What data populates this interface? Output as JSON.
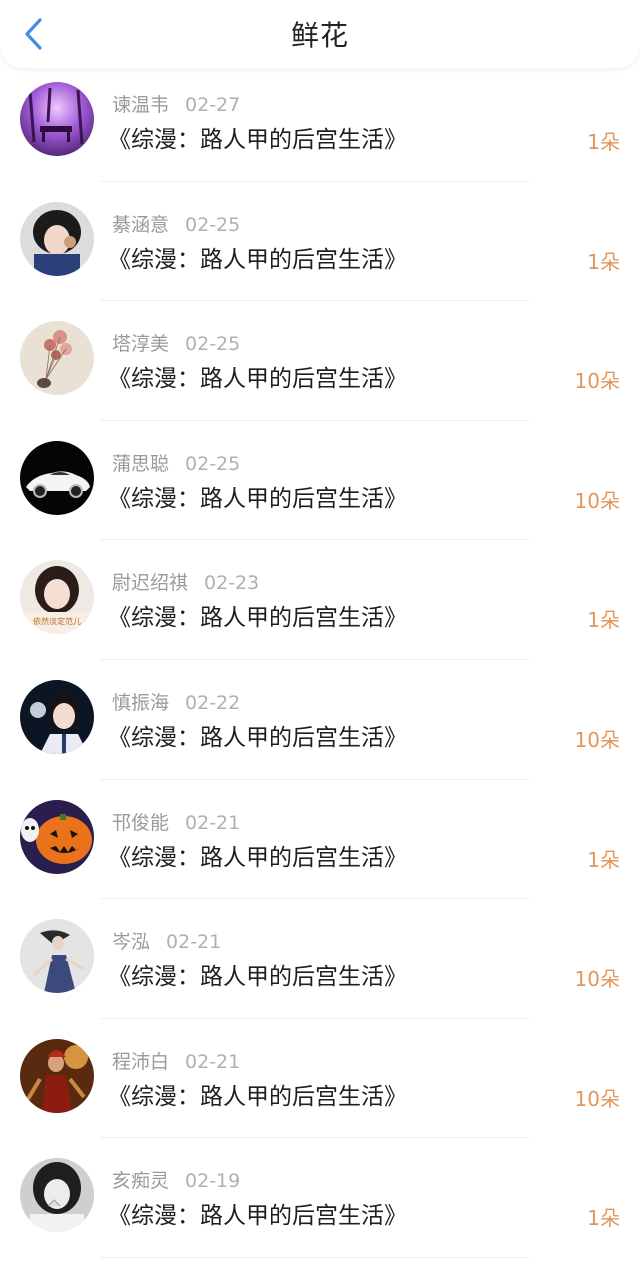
{
  "header": {
    "title": "鲜花",
    "back_icon": "chevron-left-icon",
    "accent_color": "#3d8fe6"
  },
  "gift_color": "#e3955a",
  "gifts": [
    {
      "user": "谏温韦",
      "date": "02-27",
      "book": "《综漫：路人甲的后宫生活》",
      "count": "1朵",
      "avatar": "purple-forest-avatar"
    },
    {
      "user": "綦涵意",
      "date": "02-25",
      "book": "《综漫：路人甲的后宫生活》",
      "count": "1朵",
      "avatar": "girl-photo-avatar"
    },
    {
      "user": "塔淳美",
      "date": "02-25",
      "book": "《综漫：路人甲的后宫生活》",
      "count": "10朵",
      "avatar": "balloons-avatar"
    },
    {
      "user": "蒲思聪",
      "date": "02-25",
      "book": "《综漫：路人甲的后宫生活》",
      "count": "10朵",
      "avatar": "sports-car-avatar"
    },
    {
      "user": "尉迟绍祺",
      "date": "02-23",
      "book": "《综漫：路人甲的后宫生活》",
      "count": "1朵",
      "avatar": "girl-portrait-avatar",
      "avatar_text": "依然淡定范儿"
    },
    {
      "user": "慎振海",
      "date": "02-22",
      "book": "《综漫：路人甲的后宫生活》",
      "count": "10朵",
      "avatar": "boy-portrait-avatar"
    },
    {
      "user": "邗俊能",
      "date": "02-21",
      "book": "《综漫：路人甲的后宫生活》",
      "count": "1朵",
      "avatar": "pumpkin-avatar"
    },
    {
      "user": "岑泓",
      "date": "02-21",
      "book": "《综漫：路人甲的后宫生活》",
      "count": "10朵",
      "avatar": "dancer-avatar"
    },
    {
      "user": "程沛白",
      "date": "02-21",
      "book": "《综漫：路人甲的后宫生活》",
      "count": "10朵",
      "avatar": "warrior-avatar"
    },
    {
      "user": "亥痴灵",
      "date": "02-19",
      "book": "《综漫：路人甲的后宫生活》",
      "count": "1朵",
      "avatar": "bw-girl-avatar"
    }
  ]
}
